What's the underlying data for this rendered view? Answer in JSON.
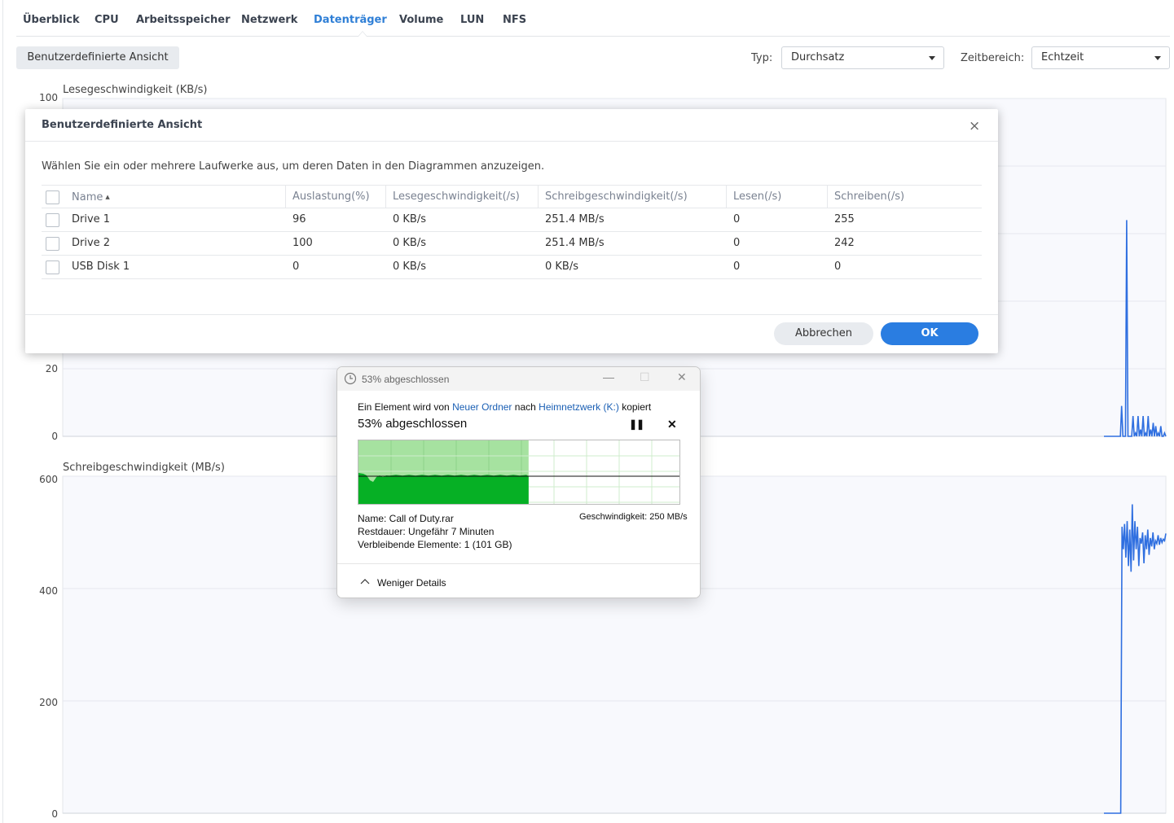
{
  "tabs": [
    {
      "label": "Überblick"
    },
    {
      "label": "CPU"
    },
    {
      "label": "Arbeitsspeicher"
    },
    {
      "label": "Netzwerk"
    },
    {
      "label": "Datenträger",
      "active": true
    },
    {
      "label": "Volume"
    },
    {
      "label": "LUN"
    },
    {
      "label": "NFS"
    }
  ],
  "toolbar": {
    "custom_view_label": "Benutzerdefinierte Ansicht",
    "type_label": "Typ:",
    "type_value": "Durchsatz",
    "range_label": "Zeitbereich:",
    "range_value": "Echtzeit"
  },
  "colors": {
    "accent": "#2a7de1",
    "active_tab": "#2f7fd6",
    "chart_line": "#2f6fe0",
    "progress_green": "#06b025",
    "progress_light": "#a6e2a0"
  },
  "chart_data": [
    {
      "type": "line",
      "title": "Lesegeschwindigkeit (KB/s)",
      "ylim": [
        0,
        100
      ],
      "yticks": [
        0,
        20,
        100
      ],
      "grid": true,
      "series": [
        {
          "values": [
            0,
            0,
            0,
            0,
            0,
            0,
            0,
            0,
            0,
            0,
            0,
            0,
            0,
            0,
            9,
            0,
            0,
            0,
            64,
            0,
            0,
            0,
            0,
            6,
            0,
            1,
            0,
            6,
            0,
            2,
            0,
            6,
            0,
            1,
            0,
            6,
            0,
            2,
            0,
            4,
            0,
            3,
            0,
            1,
            0,
            3,
            0,
            0,
            1,
            0
          ]
        }
      ]
    },
    {
      "type": "line",
      "title": "Schreibgeschwindigkeit (MB/s)",
      "ylim": [
        0,
        600
      ],
      "yticks": [
        0,
        200,
        400,
        600
      ],
      "grid": true,
      "series": [
        {
          "values": [
            0,
            0,
            0,
            0,
            0,
            0,
            0,
            0,
            0,
            0,
            0,
            0,
            0,
            0,
            510,
            470,
            515,
            455,
            520,
            440,
            505,
            430,
            550,
            450,
            520,
            470,
            510,
            440,
            490,
            480,
            500,
            445,
            495,
            470,
            505,
            460,
            490,
            475,
            500,
            470,
            485,
            480,
            495,
            478,
            490,
            482,
            488,
            485,
            498
          ]
        }
      ]
    }
  ],
  "modal": {
    "title": "Benutzerdefinierte Ansicht",
    "close": "×",
    "description": "Wählen Sie ein oder mehrere Laufwerke aus, um deren Daten in den Diagrammen anzuzeigen.",
    "columns": [
      "Name",
      "Auslastung(%)",
      "Lesegeschwindigkeit(/s)",
      "Schreibgeschwindigkeit(/s)",
      "Lesen(/s)",
      "Schreiben(/s)"
    ],
    "sort_indicator": "▲",
    "rows": [
      [
        "Drive 1",
        "96",
        "0 KB/s",
        "251.4 MB/s",
        "0",
        "255"
      ],
      [
        "Drive 2",
        "100",
        "0 KB/s",
        "251.4 MB/s",
        "0",
        "242"
      ],
      [
        "USB Disk 1",
        "0",
        "0 KB/s",
        "0 KB/s",
        "0",
        "0"
      ]
    ],
    "cancel_label": "Abbrechen",
    "ok_label": "OK"
  },
  "copy_dialog": {
    "title": "53% abgeschlossen",
    "minimize": "—",
    "maximize": "☐",
    "close": "✕",
    "line1_prefix": "Ein Element wird von",
    "source": "Neuer Ordner",
    "line1_mid": "nach",
    "destination": "Heimnetzwerk (K:)",
    "line1_suffix": "kopiert",
    "percent_text": "53% abgeschlossen",
    "progress": 0.53,
    "pause": "❚❚",
    "stop": "✕",
    "speed_text": "Geschwindigkeit: 250 MB/s",
    "name_text": "Name:  Call of Duty.rar",
    "remaining_text": "Restdauer:  Ungefähr 7 Minuten",
    "items_text": "Verbleibende Elemente:  1 (101 GB)",
    "less_details": "Weniger Details"
  }
}
